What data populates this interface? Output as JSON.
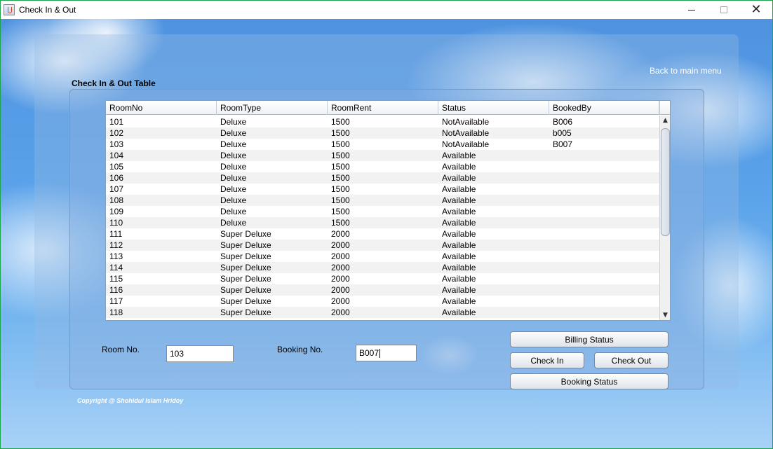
{
  "window": {
    "title": "Check In & Out"
  },
  "header": {
    "back_link": "Back to main menu",
    "section_title": "Check In & Out Table"
  },
  "table": {
    "columns": [
      "RoomNo",
      "RoomType",
      "RoomRent",
      "Status",
      "BookedBy"
    ],
    "rows": [
      [
        "101",
        "Deluxe",
        "1500",
        "NotAvailable",
        "B006"
      ],
      [
        "102",
        "Deluxe",
        "1500",
        "NotAvailable",
        "b005"
      ],
      [
        "103",
        "Deluxe",
        "1500",
        "NotAvailable",
        "B007"
      ],
      [
        "104",
        "Deluxe",
        "1500",
        "Available",
        ""
      ],
      [
        "105",
        "Deluxe",
        "1500",
        "Available",
        ""
      ],
      [
        "106",
        "Deluxe",
        "1500",
        "Available",
        ""
      ],
      [
        "107",
        "Deluxe",
        "1500",
        "Available",
        ""
      ],
      [
        "108",
        "Deluxe",
        "1500",
        "Available",
        ""
      ],
      [
        "109",
        "Deluxe",
        "1500",
        "Available",
        ""
      ],
      [
        "110",
        "Deluxe",
        "1500",
        "Available",
        ""
      ],
      [
        "111",
        "Super Deluxe",
        "2000",
        "Available",
        ""
      ],
      [
        "112",
        "Super Deluxe",
        "2000",
        "Available",
        ""
      ],
      [
        "113",
        "Super Deluxe",
        "2000",
        "Available",
        ""
      ],
      [
        "114",
        "Super Deluxe",
        "2000",
        "Available",
        ""
      ],
      [
        "115",
        "Super Deluxe",
        "2000",
        "Available",
        ""
      ],
      [
        "116",
        "Super Deluxe",
        "2000",
        "Available",
        ""
      ],
      [
        "117",
        "Super Deluxe",
        "2000",
        "Available",
        ""
      ],
      [
        "118",
        "Super Deluxe",
        "2000",
        "Available",
        ""
      ]
    ]
  },
  "form": {
    "room_label": "Room No.",
    "room_value": "103",
    "booking_label": "Booking No.",
    "booking_value": "B007"
  },
  "buttons": {
    "billing_status": "Billing Status",
    "check_in": "Check In",
    "check_out": "Check Out",
    "booking_status": "Booking Status"
  },
  "footer": {
    "copyright": "Copyright @ Shohidul Islam Hridoy"
  },
  "icons": {
    "app": "java-cup-icon",
    "minimize": "minimize-icon",
    "maximize": "maximize-icon",
    "close": "close-icon",
    "scroll_up": "arrow-up-icon",
    "scroll_down": "arrow-down-icon"
  }
}
